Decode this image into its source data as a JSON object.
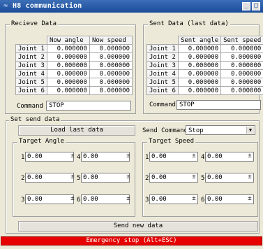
{
  "window": {
    "title": "H8 communication"
  },
  "receive": {
    "title": "Recieve Data",
    "headers": [
      "Now angle",
      "Now speed"
    ],
    "rows": [
      {
        "label": "Joint 1",
        "a": "0.000000",
        "b": "0.000000"
      },
      {
        "label": "Joint 2",
        "a": "0.000000",
        "b": "0.000000"
      },
      {
        "label": "Joint 3",
        "a": "0.000000",
        "b": "0.000000"
      },
      {
        "label": "Joint 4",
        "a": "0.000000",
        "b": "0.000000"
      },
      {
        "label": "Joint 5",
        "a": "0.000000",
        "b": "0.000000"
      },
      {
        "label": "Joint 6",
        "a": "0.000000",
        "b": "0.000000"
      }
    ],
    "command_label": "Command",
    "command_value": "STOP"
  },
  "sent": {
    "title": "Sent Data (last data)",
    "headers": [
      "Sent angle",
      "Sent speed"
    ],
    "rows": [
      {
        "label": "Joint 1",
        "a": "0.000000",
        "b": "0.000000"
      },
      {
        "label": "Joint 2",
        "a": "0.000000",
        "b": "0.000000"
      },
      {
        "label": "Joint 3",
        "a": "0.000000",
        "b": "0.000000"
      },
      {
        "label": "Joint 4",
        "a": "0.000000",
        "b": "0.000000"
      },
      {
        "label": "Joint 5",
        "a": "0.000000",
        "b": "0.000000"
      },
      {
        "label": "Joint 6",
        "a": "0.000000",
        "b": "0.000000"
      }
    ],
    "command_label": "Command",
    "command_value": "STOP"
  },
  "set_send": {
    "title": "Set send data",
    "load_button": "Load last data",
    "send_command_label": "Send Command",
    "send_command_value": "Stop",
    "target_angle": {
      "title": "Target Angle",
      "fields": [
        {
          "num": "1",
          "value": "0.00"
        },
        {
          "num": "4",
          "value": "0.00"
        },
        {
          "num": "2",
          "value": "0.00"
        },
        {
          "num": "5",
          "value": "0.00"
        },
        {
          "num": "3",
          "value": "0.00"
        },
        {
          "num": "6",
          "value": "0.00"
        }
      ]
    },
    "target_speed": {
      "title": "Target Speed",
      "fields": [
        {
          "num": "1",
          "value": "0.00"
        },
        {
          "num": "4",
          "value": "0.00"
        },
        {
          "num": "2",
          "value": "0.00"
        },
        {
          "num": "5",
          "value": "0.00"
        },
        {
          "num": "3",
          "value": "0.00"
        },
        {
          "num": "6",
          "value": "0.00"
        }
      ]
    },
    "send_button": "Send new data"
  },
  "emergency": {
    "label": "Emergency stop (Alt+ESC)"
  },
  "icons": {
    "spin": "±",
    "dropdown": "▼",
    "window": "≈"
  },
  "colors": {
    "titlebar": "#1b4c98",
    "emergency": "#e60000"
  }
}
